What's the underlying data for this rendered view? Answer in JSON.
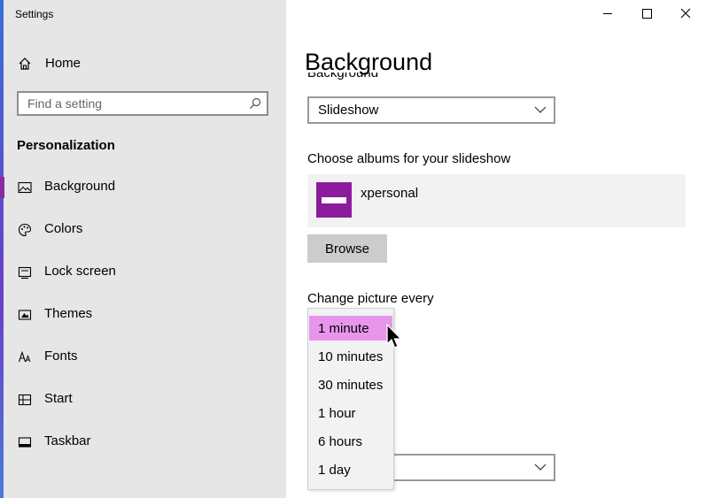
{
  "window": {
    "title": "Settings",
    "controls": {
      "minimize": "minimize-icon",
      "maximize": "maximize-icon",
      "close": "close-icon"
    }
  },
  "sidebar": {
    "home_label": "Home",
    "search": {
      "placeholder": "Find a setting"
    },
    "section_title": "Personalization",
    "items": [
      {
        "label": "Background",
        "icon": "image-icon",
        "active": true
      },
      {
        "label": "Colors",
        "icon": "palette-icon",
        "active": false
      },
      {
        "label": "Lock screen",
        "icon": "lock-screen-icon",
        "active": false
      },
      {
        "label": "Themes",
        "icon": "themes-icon",
        "active": false
      },
      {
        "label": "Fonts",
        "icon": "fonts-icon",
        "active": false
      },
      {
        "label": "Start",
        "icon": "start-icon",
        "active": false
      },
      {
        "label": "Taskbar",
        "icon": "taskbar-icon",
        "active": false
      }
    ]
  },
  "main": {
    "page_title": "Background",
    "background_label": "Background",
    "background_value": "Slideshow",
    "albums_label": "Choose albums for your slideshow",
    "album_name": "xpersonal",
    "browse_label": "Browse",
    "change_label": "Change picture every",
    "interval_options": [
      "1 minute",
      "10 minutes",
      "30 minutes",
      "1 hour",
      "6 hours",
      "1 day"
    ],
    "interval_selected": "1 minute"
  },
  "colors": {
    "accent": "#8b1c9c",
    "highlight": "#e896ec",
    "sidebar_bg": "#e6e6e6"
  }
}
